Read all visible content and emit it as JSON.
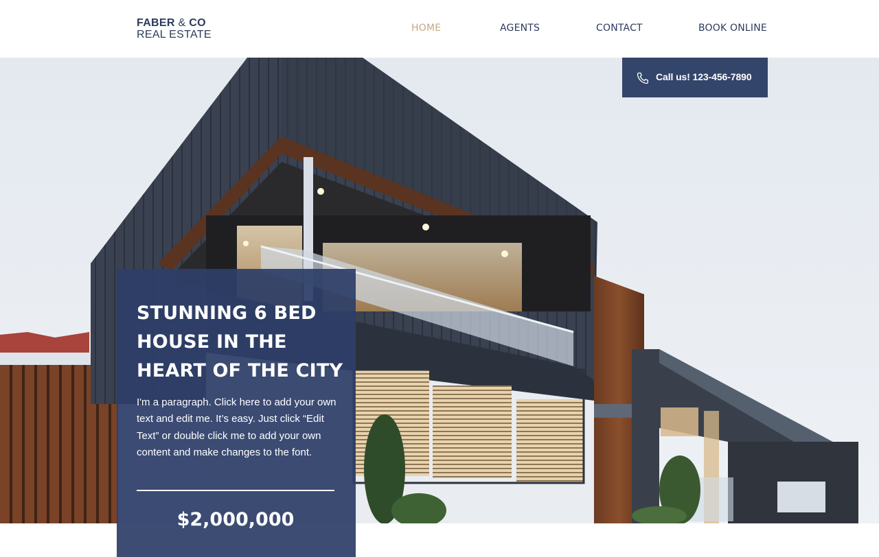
{
  "logo": {
    "line1_a": "FABER",
    "line1_amp": "&",
    "line1_b": "CO",
    "line2": "REAL ESTATE"
  },
  "nav": {
    "items": [
      {
        "label": "HOME",
        "active": true
      },
      {
        "label": "AGENTS",
        "active": false
      },
      {
        "label": "CONTACT",
        "active": false
      },
      {
        "label": "BOOK ONLINE",
        "active": false
      }
    ]
  },
  "call": {
    "label": "Call us! 123-456-7890",
    "icon": "phone-icon"
  },
  "listing": {
    "title": "STUNNING 6 BED HOUSE IN THE HEART OF THE CITY",
    "paragraph": "I'm a paragraph. Click here to add your own text and edit me. It’s easy. Just click “Edit Text” or double click me to add your own content and make changes to the font.",
    "price": "$2,000,000"
  },
  "colors": {
    "navy": "#2d3e68",
    "accent_gold": "#c4a783",
    "text_dark": "#2c3a5c"
  }
}
